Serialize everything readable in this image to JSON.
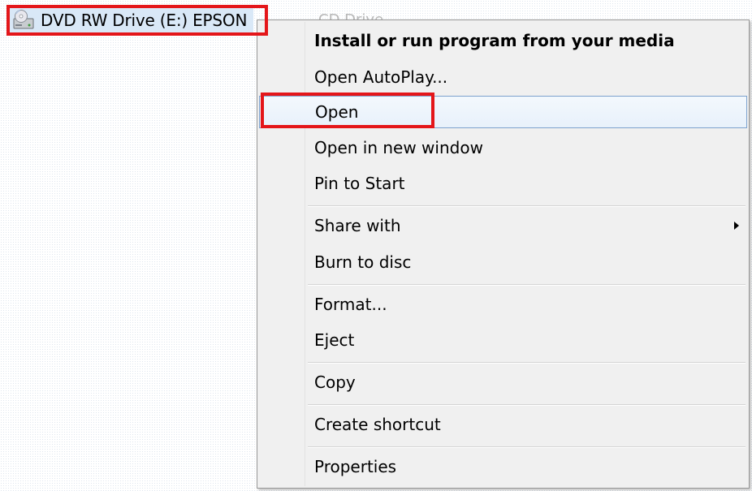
{
  "explorer": {
    "drive_label": "DVD RW Drive (E:) EPSON",
    "drive_type": "CD Drive"
  },
  "context_menu": {
    "install_label": "Install or run program from your media",
    "autoplay_label": "Open AutoPlay...",
    "open_label": "Open",
    "open_new_window_label": "Open in new window",
    "pin_to_start_label": "Pin to Start",
    "share_with_label": "Share with",
    "burn_label": "Burn to disc",
    "format_label": "Format...",
    "eject_label": "Eject",
    "copy_label": "Copy",
    "create_shortcut_label": "Create shortcut",
    "properties_label": "Properties"
  },
  "colors": {
    "highlight_box": "#e4161a",
    "hover_border": "#7da2ce",
    "menu_background": "#f0f0f0"
  },
  "icons": {
    "drive": "dvd-drive-icon",
    "submenu": "submenu-arrow-icon"
  }
}
